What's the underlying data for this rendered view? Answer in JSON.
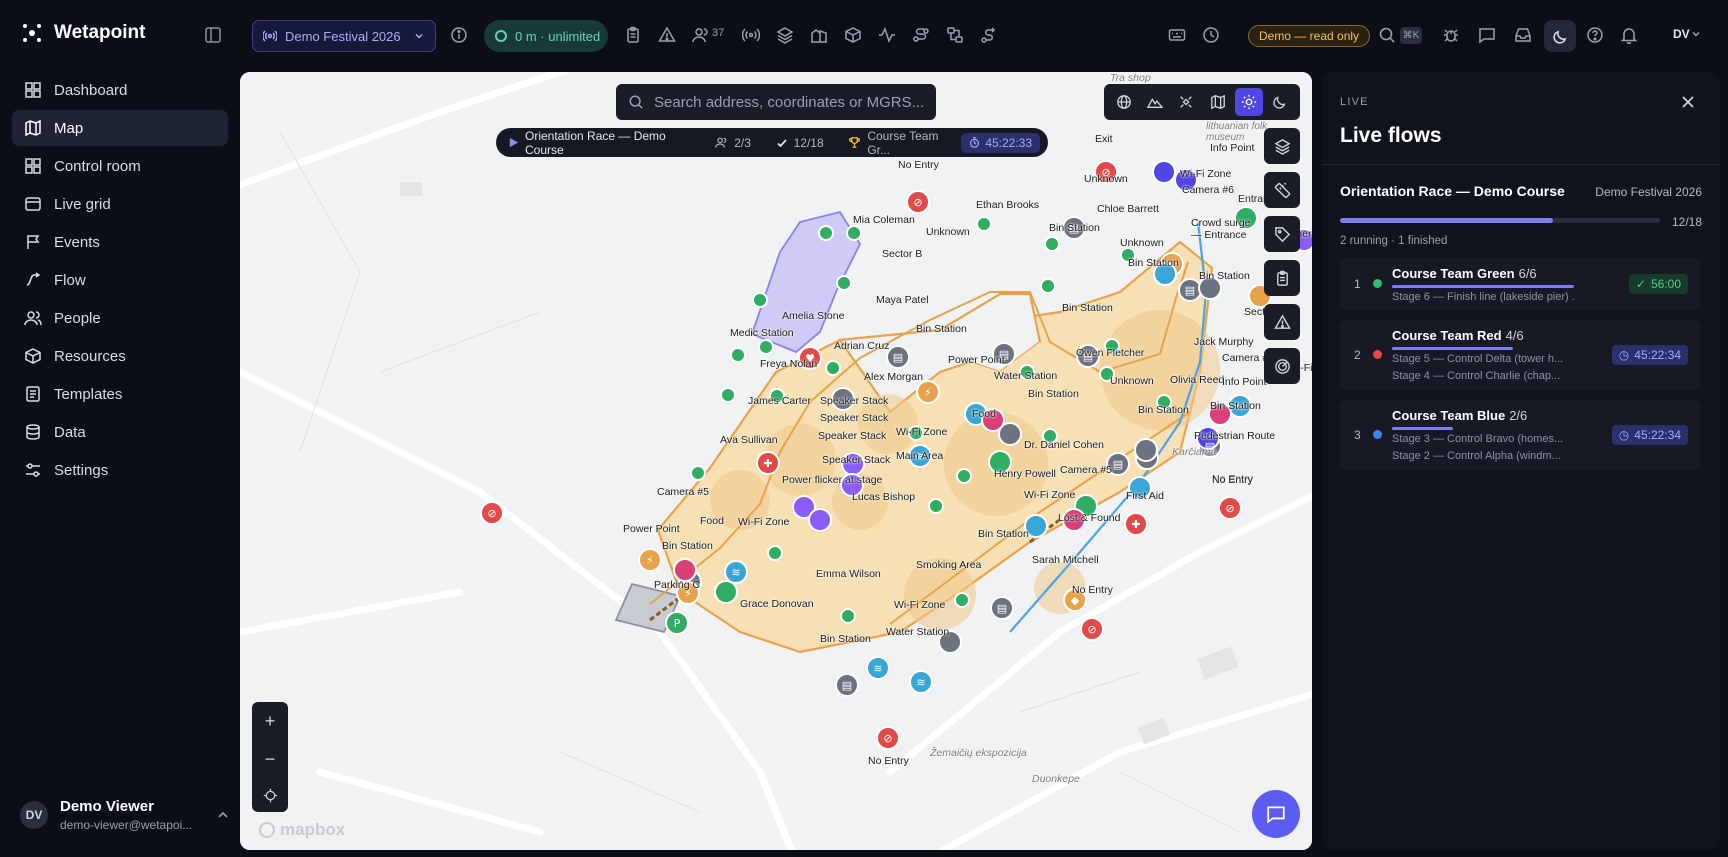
{
  "app": {
    "name": "Wetapoint"
  },
  "nav": [
    {
      "label": "Dashboard",
      "icon": "dashboard-icon"
    },
    {
      "label": "Map",
      "icon": "map-icon",
      "active": true
    },
    {
      "label": "Control room",
      "icon": "grid-icon"
    },
    {
      "label": "Live grid",
      "icon": "live-grid-icon"
    },
    {
      "label": "Events",
      "icon": "events-icon"
    },
    {
      "label": "Flow",
      "icon": "flow-icon"
    },
    {
      "label": "People",
      "icon": "people-icon"
    },
    {
      "label": "Resources",
      "icon": "box-icon"
    },
    {
      "label": "Templates",
      "icon": "templates-icon"
    },
    {
      "label": "Data",
      "icon": "database-icon"
    },
    {
      "label": "Settings",
      "icon": "settings-icon"
    }
  ],
  "user": {
    "initials": "DV",
    "name": "Demo Viewer",
    "email": "demo-viewer@wetapoi..."
  },
  "topbar": {
    "event": "Demo Festival 2026",
    "radius": "0 m · unlimited",
    "people_count": "37",
    "demo_badge": "Demo — read only",
    "kbd": "⌘K",
    "avatar": "DV"
  },
  "map": {
    "search_placeholder": "Search address, coordinates or MGRS...",
    "route": {
      "name": "Orientation Race — Demo Course",
      "teams": "2/3",
      "checkpoints": "12/18",
      "leader": "Course Team Gr...",
      "timer": "45:22:33"
    },
    "attribution": "mapbox",
    "labels": [
      {
        "t": "No Entry"
      },
      {
        "t": "Exit"
      },
      {
        "t": "Info Point"
      },
      {
        "t": "Stay at lithuanian folk museum"
      },
      {
        "t": "Unknown"
      },
      {
        "t": "Wi-Fi Zone"
      },
      {
        "t": "Camera #6"
      },
      {
        "t": "Entrance"
      },
      {
        "t": "Ethan Brooks"
      },
      {
        "t": "Chloe Barrett"
      },
      {
        "t": "Crowd surge — Entrance"
      },
      {
        "t": "Mia Coleman"
      },
      {
        "t": "Unknown"
      },
      {
        "t": "Bin Station"
      },
      {
        "t": "Sector B"
      },
      {
        "t": "Unknown"
      },
      {
        "t": "Bin Station"
      },
      {
        "t": "Bin Station"
      },
      {
        "t": "Camera"
      },
      {
        "t": "Maya Patel"
      },
      {
        "t": "Amelia Stone"
      },
      {
        "t": "Medic Station"
      },
      {
        "t": "Bin Station"
      },
      {
        "t": "Bin Station"
      },
      {
        "t": "Sector C"
      },
      {
        "t": "Adrian Cruz"
      },
      {
        "t": "Owen Fletcher"
      },
      {
        "t": "Jack Murphy"
      },
      {
        "t": "Freya Nolan"
      },
      {
        "t": "Power Point"
      },
      {
        "t": "Camera #6"
      },
      {
        "t": "Alex Morgan"
      },
      {
        "t": "Water Station"
      },
      {
        "t": "Unknown"
      },
      {
        "t": "Olivia Reed"
      },
      {
        "t": "Info Point"
      },
      {
        "t": "Wi-Fi"
      },
      {
        "t": "Bin Station"
      },
      {
        "t": "James Carter"
      },
      {
        "t": "Speaker Stack"
      },
      {
        "t": "Food"
      },
      {
        "t": "Bin Station"
      },
      {
        "t": "Bin Station"
      },
      {
        "t": "Speaker Stack"
      },
      {
        "t": "Wi-Fi Zone"
      },
      {
        "t": "Pedestrian Route"
      },
      {
        "t": "Ava Sullivan"
      },
      {
        "t": "Speaker Stack"
      },
      {
        "t": "Dr. Daniel Cohen"
      },
      {
        "t": "Main Area"
      },
      {
        "t": "Speaker Stack"
      },
      {
        "t": "Karčiama"
      },
      {
        "t": "No Entry"
      },
      {
        "t": "Henry Powell"
      },
      {
        "t": "Camera #5"
      },
      {
        "t": "Power flicker at stage"
      },
      {
        "t": "First Aid"
      },
      {
        "t": "No Entry"
      },
      {
        "t": "Wi-Fi Zone"
      },
      {
        "t": "Lucas Bishop"
      },
      {
        "t": "Camera #5"
      },
      {
        "t": "Lost & Found"
      },
      {
        "t": "Food"
      },
      {
        "t": "Power Point"
      },
      {
        "t": "Wi-Fi Zone"
      },
      {
        "t": "Bin Station"
      },
      {
        "t": "Bin Station"
      },
      {
        "t": "Sarah Mitchell"
      },
      {
        "t": "Parking C"
      },
      {
        "t": "Emma Wilson"
      },
      {
        "t": "Smoking Area"
      },
      {
        "t": "No Entry"
      },
      {
        "t": "Grace Donovan"
      },
      {
        "t": "Wi-Fi Zone"
      },
      {
        "t": "Bin Station"
      },
      {
        "t": "Water Station"
      },
      {
        "t": "Žemaičių ekspozicija"
      },
      {
        "t": "No Entry"
      },
      {
        "t": "Duonkepe"
      },
      {
        "t": "Tra shop"
      }
    ]
  },
  "panel": {
    "tag": "LIVE",
    "title": "Live flows",
    "flow": {
      "name": "Orientation Race — Demo Course",
      "event": "Demo Festival 2026",
      "count": "12/18",
      "progress": 0.667,
      "status": "2 running · 1 finished"
    },
    "teams": [
      {
        "rank": "1",
        "name": "Course Team Green",
        "score": "6/6",
        "progress": 1.0,
        "color": "#2fbf71",
        "line1": "Stage 6 — Finish line (lakeside pier) ...",
        "line2": "",
        "badge": "56:00",
        "badge_kind": "done"
      },
      {
        "rank": "2",
        "name": "Course Team Red",
        "score": "4/6",
        "progress": 0.667,
        "color": "#ef4444",
        "line1": "Stage 5 — Control Delta (tower h...",
        "line2": "Stage 4 — Control Charlie (chap...",
        "badge": "45:22:34",
        "badge_kind": "timer"
      },
      {
        "rank": "3",
        "name": "Course Team Blue",
        "score": "2/6",
        "progress": 0.333,
        "color": "#3b82f6",
        "line1": "Stage 3 — Control Bravo (homes...",
        "line2": "Stage 2 — Control Alpha (windm...",
        "badge": "45:22:34",
        "badge_kind": "timer"
      }
    ]
  }
}
